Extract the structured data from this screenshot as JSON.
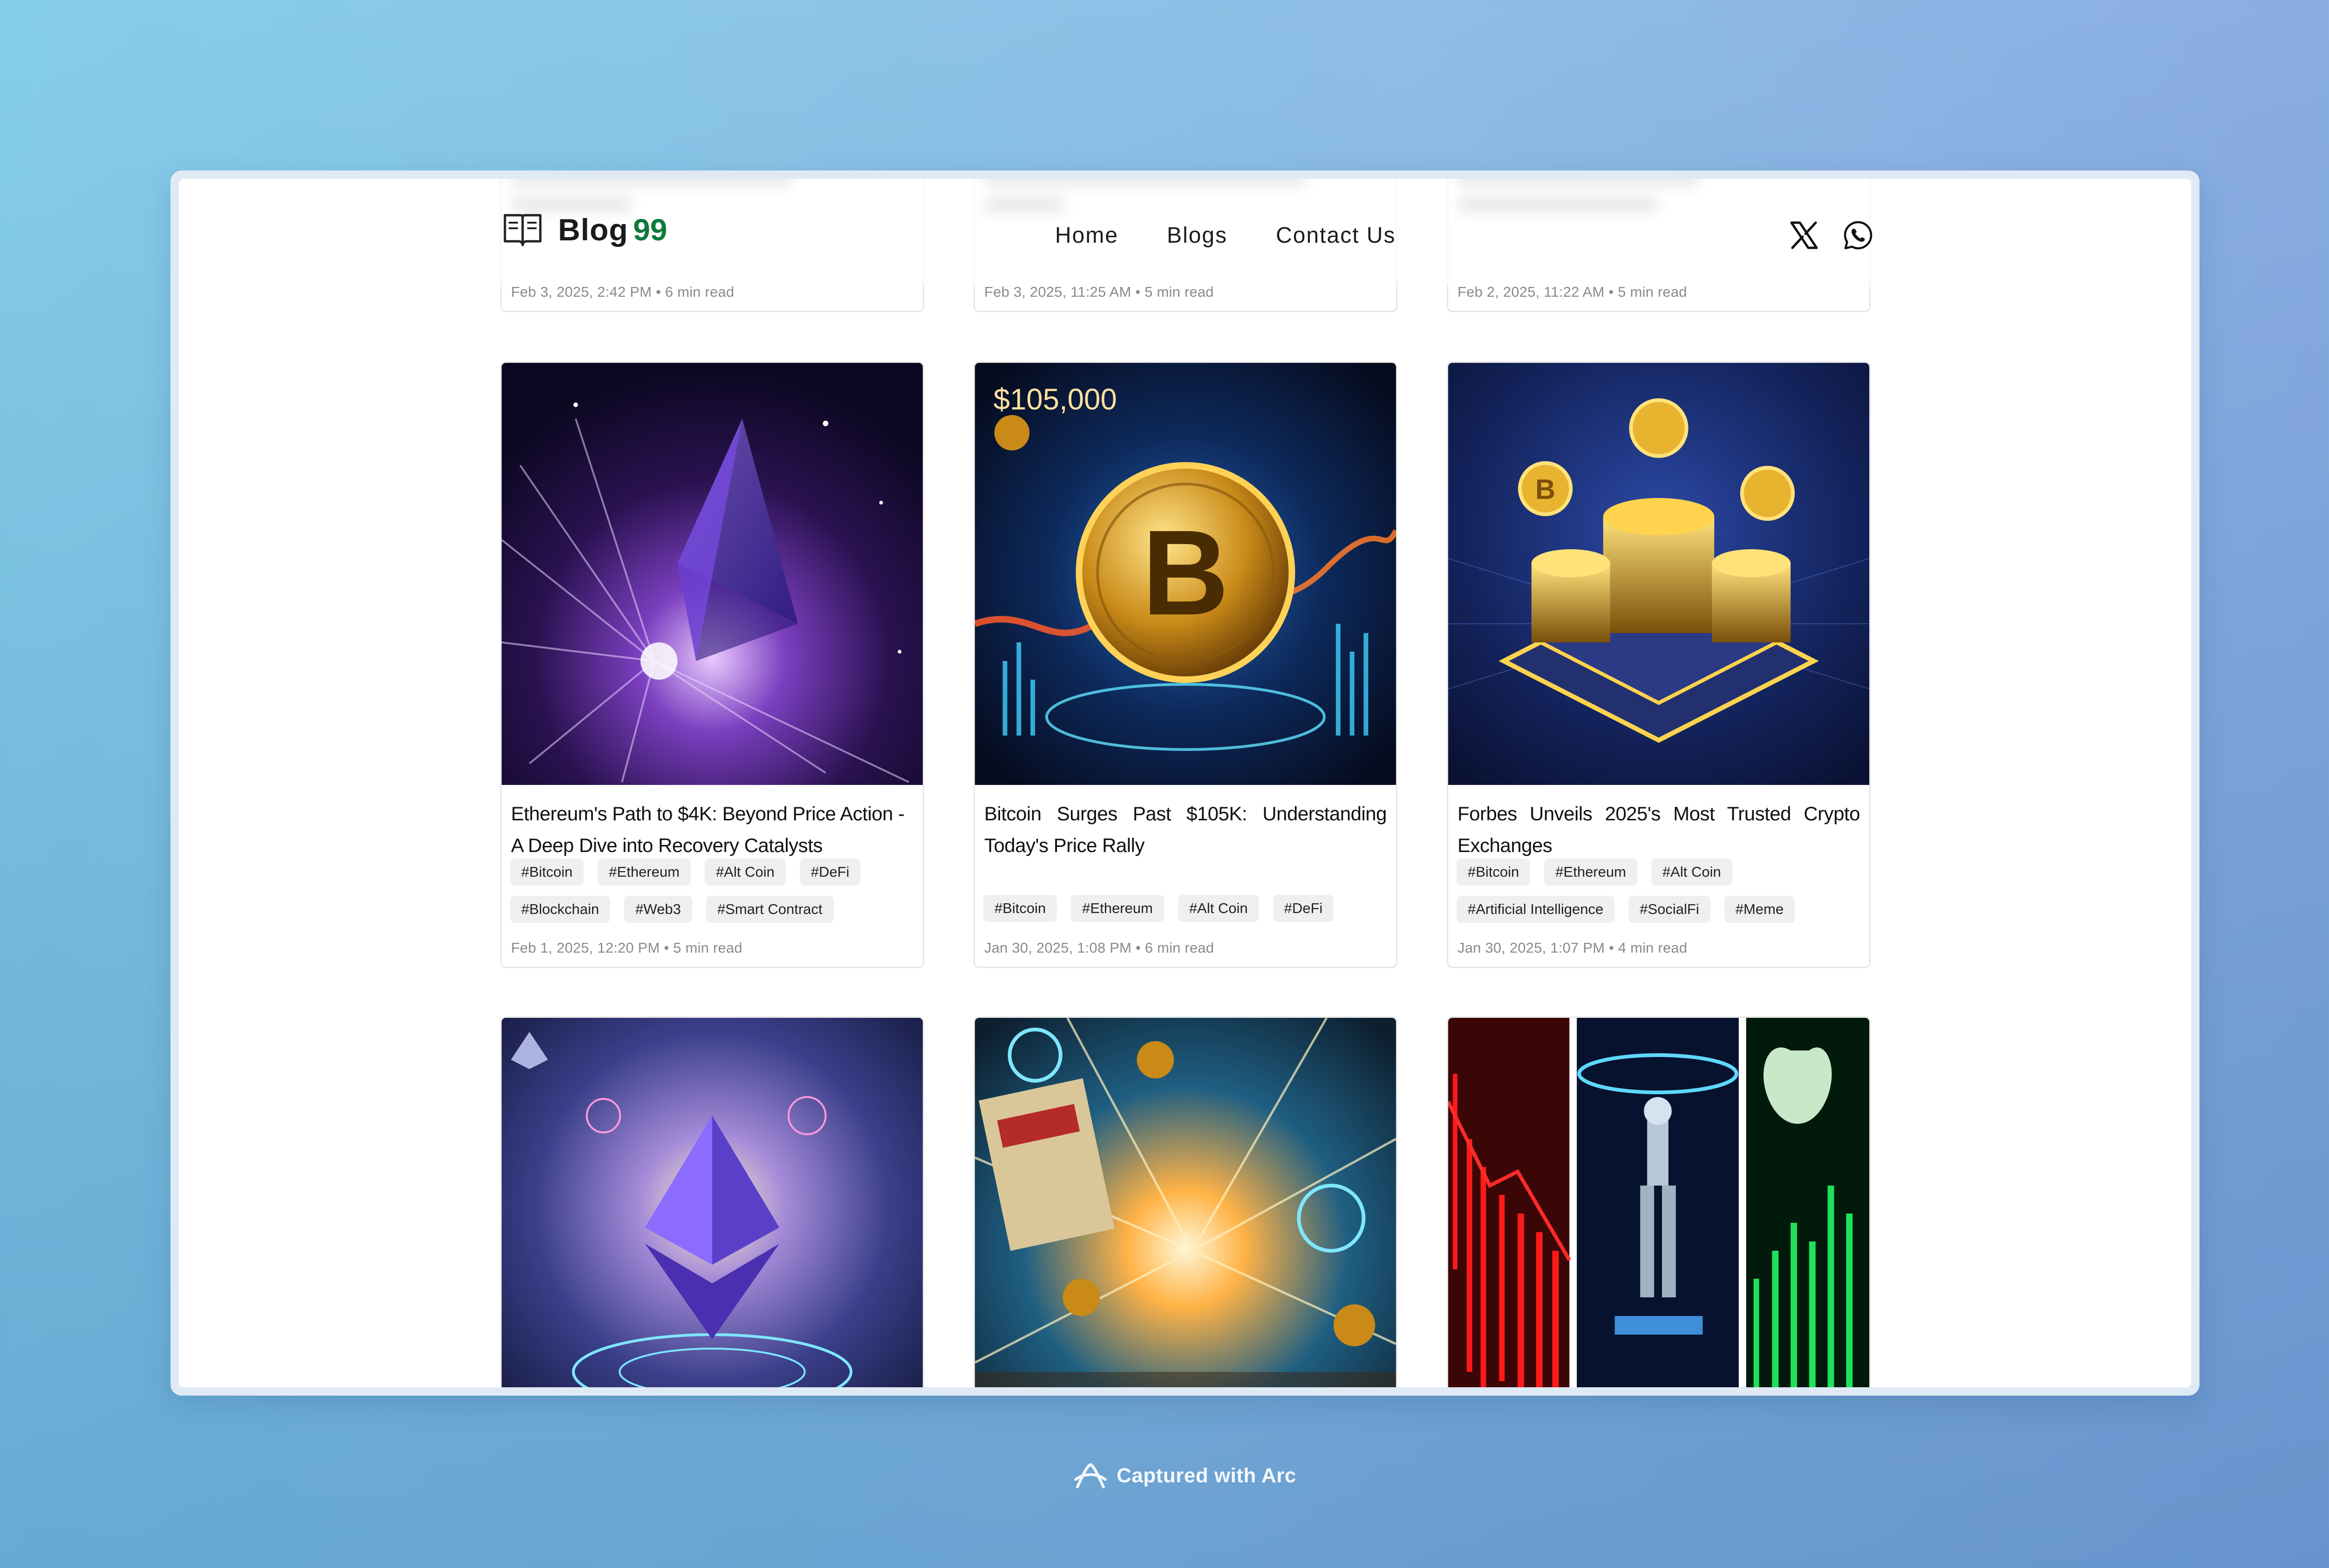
{
  "header": {
    "logo_text": "Blog",
    "logo_number": "99",
    "nav": [
      "Home",
      "Blogs",
      "Contact Us"
    ],
    "social_icons": [
      "x-icon",
      "whatsapp-icon"
    ]
  },
  "posts_top_row": [
    {
      "meta": "Feb 3, 2025, 2:42 PM • 6 min read"
    },
    {
      "meta": "Feb 3, 2025, 11:25 AM • 5 min read"
    },
    {
      "meta": "Feb 2, 2025, 11:22 AM • 5 min read"
    }
  ],
  "posts": [
    {
      "title": "Ethereum's Path to $4K: Beyond Price Action - A Deep Dive into Recovery Catalysts",
      "tags": [
        "#Bitcoin",
        "#Ethereum",
        "#Alt Coin",
        "#DeFi",
        "#Blockchain",
        "#Web3",
        "#Smart Contract"
      ],
      "meta": "Feb 1, 2025, 12:20 PM • 5 min read"
    },
    {
      "title": "Bitcoin Surges Past $105K: Understanding Today's Price Rally",
      "tags": [
        "#Bitcoin",
        "#Ethereum",
        "#Alt Coin",
        "#DeFi"
      ],
      "meta": "Jan 30, 2025, 1:08 PM • 6 min read",
      "image_text": "$105,000"
    },
    {
      "title": "Forbes Unveils 2025's Most Trusted Crypto Exchanges",
      "tags": [
        "#Bitcoin",
        "#Ethereum",
        "#Alt Coin",
        "#Artificial Intelligence",
        "#SocialFi",
        "#Meme"
      ],
      "meta": "Jan 30, 2025, 1:07 PM • 4 min read"
    }
  ],
  "footer": {
    "text": "Captured with Arc"
  },
  "colors": {
    "accent_green": "#0f7a3a",
    "tag_bg": "#efefef",
    "meta_gray": "#8a8a8a"
  }
}
